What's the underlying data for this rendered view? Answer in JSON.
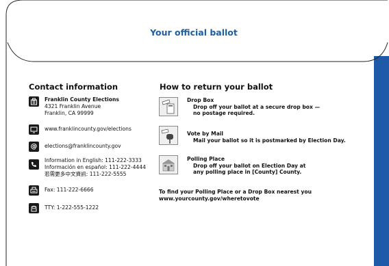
{
  "envelope": {
    "title": "Your official ballot"
  },
  "contact": {
    "heading": "Contact information",
    "office_name": "Franklin County Elections",
    "address_line1": "4321 Franklin Avenue",
    "address_line2": "Franklin, CA 99999",
    "website": "www.franklincounty.gov/elections",
    "email": "elections@franklincounty.gov",
    "phone_en": "Information in English: 111-222-3333",
    "phone_es": "Información en español: 111-222-4444",
    "phone_zh": "若需更多中文資訊: 111-222-5555",
    "fax": "Fax: 111-222-6666",
    "tty": "TTY: 1-222-555-1222"
  },
  "return": {
    "heading": "How to return your ballot",
    "options": [
      {
        "title": "Drop Box",
        "line1": "Drop off your ballot at a secure drop box —",
        "line2": "no postage required.",
        "icon": "drop-box-icon"
      },
      {
        "title": "Vote by Mail",
        "line1": "Mail your ballot so it is postmarked by Election Day.",
        "line2": "",
        "icon": "mailbox-icon"
      },
      {
        "title": "Polling Place",
        "line1": "Drop off your ballot on Election Day at",
        "line2": "any polling place in [County] County.",
        "icon": "polling-place-icon"
      }
    ],
    "footer_line1": "To find your Polling Place or a Drop Box nearest you",
    "footer_line2": "www.yourcounty.gov/wheretovote"
  },
  "colors": {
    "title_blue": "#1d5fa7",
    "strip_blue": "#1f5aa8"
  }
}
